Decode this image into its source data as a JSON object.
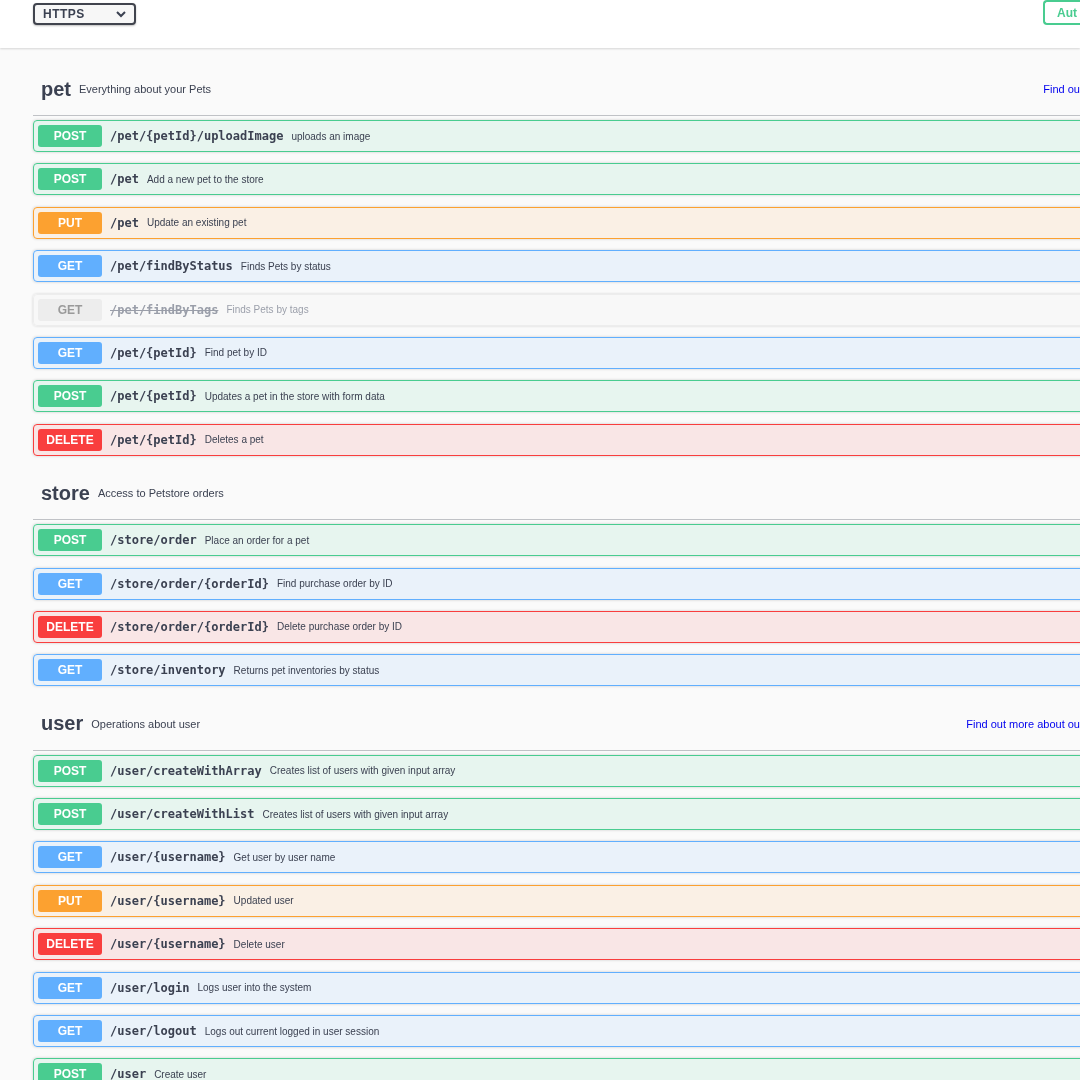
{
  "header": {
    "scheme_select": {
      "value": "HTTPS"
    },
    "authorize_button": {
      "label": "Aut"
    }
  },
  "sections": [
    {
      "name": "pet",
      "description": "Everything about your Pets",
      "link": "Find ou",
      "operations": [
        {
          "method": "POST",
          "path": "/pet/{petId}/uploadImage",
          "summary": "uploads an image",
          "deprecated": false
        },
        {
          "method": "POST",
          "path": "/pet",
          "summary": "Add a new pet to the store",
          "deprecated": false
        },
        {
          "method": "PUT",
          "path": "/pet",
          "summary": "Update an existing pet",
          "deprecated": false
        },
        {
          "method": "GET",
          "path": "/pet/findByStatus",
          "summary": "Finds Pets by status",
          "deprecated": false
        },
        {
          "method": "GET",
          "path": "/pet/findByTags",
          "summary": "Finds Pets by tags",
          "deprecated": true
        },
        {
          "method": "GET",
          "path": "/pet/{petId}",
          "summary": "Find pet by ID",
          "deprecated": false
        },
        {
          "method": "POST",
          "path": "/pet/{petId}",
          "summary": "Updates a pet in the store with form data",
          "deprecated": false
        },
        {
          "method": "DELETE",
          "path": "/pet/{petId}",
          "summary": "Deletes a pet",
          "deprecated": false
        }
      ]
    },
    {
      "name": "store",
      "description": "Access to Petstore orders",
      "operations": [
        {
          "method": "POST",
          "path": "/store/order",
          "summary": "Place an order for a pet",
          "deprecated": false
        },
        {
          "method": "GET",
          "path": "/store/order/{orderId}",
          "summary": "Find purchase order by ID",
          "deprecated": false
        },
        {
          "method": "DELETE",
          "path": "/store/order/{orderId}",
          "summary": "Delete purchase order by ID",
          "deprecated": false
        },
        {
          "method": "GET",
          "path": "/store/inventory",
          "summary": "Returns pet inventories by status",
          "deprecated": false
        }
      ]
    },
    {
      "name": "user",
      "description": "Operations about user",
      "link": "Find out more about ou",
      "operations": [
        {
          "method": "POST",
          "path": "/user/createWithArray",
          "summary": "Creates list of users with given input array",
          "deprecated": false
        },
        {
          "method": "POST",
          "path": "/user/createWithList",
          "summary": "Creates list of users with given input array",
          "deprecated": false
        },
        {
          "method": "GET",
          "path": "/user/{username}",
          "summary": "Get user by user name",
          "deprecated": false
        },
        {
          "method": "PUT",
          "path": "/user/{username}",
          "summary": "Updated user",
          "deprecated": false
        },
        {
          "method": "DELETE",
          "path": "/user/{username}",
          "summary": "Delete user",
          "deprecated": false
        },
        {
          "method": "GET",
          "path": "/user/login",
          "summary": "Logs user into the system",
          "deprecated": false
        },
        {
          "method": "GET",
          "path": "/user/logout",
          "summary": "Logs out current logged in user session",
          "deprecated": false
        },
        {
          "method": "POST",
          "path": "/user",
          "summary": "Create user",
          "deprecated": false
        }
      ]
    }
  ]
}
